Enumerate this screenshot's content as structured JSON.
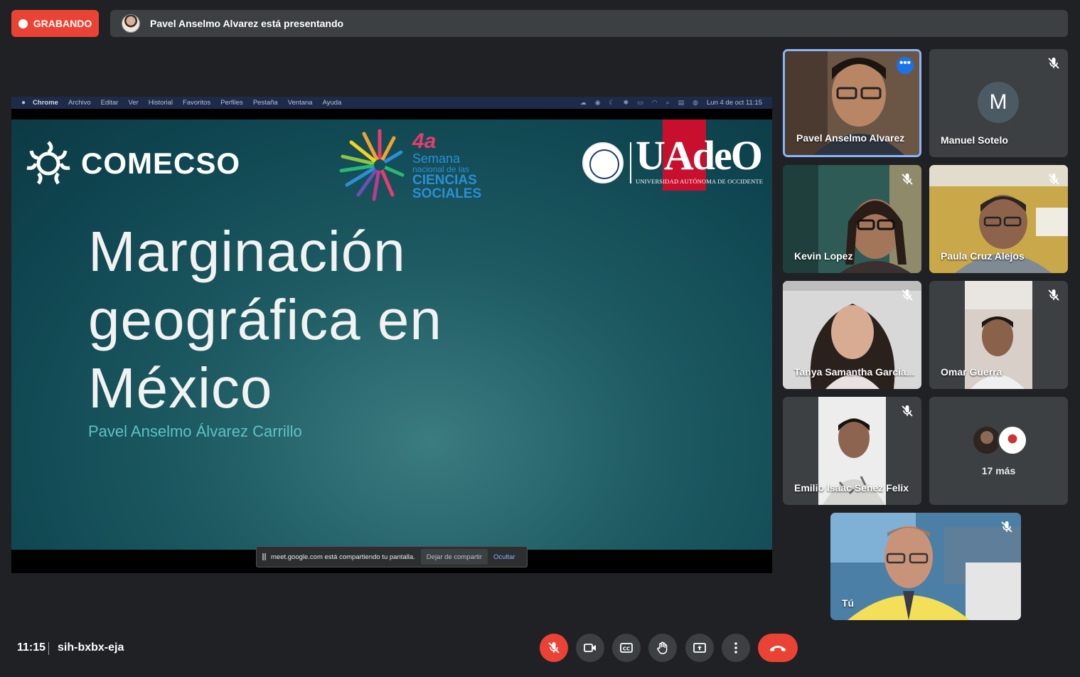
{
  "recording": {
    "label": "GRABANDO"
  },
  "presenting": {
    "text": "Pavel Anselmo Alvarez está presentando"
  },
  "mac_menubar": {
    "items": [
      "Chrome",
      "Archivo",
      "Editar",
      "Ver",
      "Historial",
      "Favoritos",
      "Perfiles",
      "Pestaña",
      "Ventana",
      "Ayuda"
    ],
    "datetime": "Lun 4 de oct  11:15"
  },
  "slide": {
    "logo_left": "COMECSO",
    "event_number": "4a",
    "event_line1": "Semana",
    "event_line2": "nacional de las",
    "event_line3": "CIENCIAS",
    "event_line4": "SOCIALES",
    "logo_right": "UAdeO",
    "logo_right_sub": "UNIVERSIDAD AUTÓNOMA DE OCCIDENTE",
    "title_line1": "Marginación",
    "title_line2": "geográfica en",
    "title_line3": "México",
    "author": "Pavel Anselmo Álvarez Carrillo"
  },
  "share_notice": {
    "message": "meet.google.com está compartiendo tu pantalla.",
    "stop_label": "Dejar de compartir",
    "hide_label": "Ocultar"
  },
  "participants": [
    {
      "name": "Pavel Anselmo Alvarez",
      "muted": false,
      "active": true
    },
    {
      "name": "Manuel Sotelo",
      "muted": true,
      "initial": "M"
    },
    {
      "name": "Kevin Lopez",
      "muted": true
    },
    {
      "name": "Paula Cruz Alejos",
      "muted": true
    },
    {
      "name": "Tanya Samantha Garcia...",
      "muted": true
    },
    {
      "name": "Omar Guerra",
      "muted": true
    },
    {
      "name": "Emilio Isaac Senez Felix",
      "muted": true
    },
    {
      "name": "Tú",
      "muted": true
    }
  ],
  "more_participants": {
    "label": "17 más"
  },
  "bottom_bar": {
    "time": "11:15",
    "meeting_code": "sih-bxbx-eja"
  },
  "controls": [
    {
      "icon": "mic-off-icon",
      "state": "off"
    },
    {
      "icon": "camera-icon"
    },
    {
      "icon": "captions-icon"
    },
    {
      "icon": "raise-hand-icon"
    },
    {
      "icon": "present-screen-icon"
    },
    {
      "icon": "more-options-icon"
    },
    {
      "icon": "end-call-icon"
    }
  ],
  "colors": {
    "background": "#202124",
    "tile": "#3c4043",
    "danger": "#ea4335",
    "accent": "#8ab4f8",
    "slide_teal": "#1d5a62",
    "author_teal": "#5bc3c6"
  }
}
